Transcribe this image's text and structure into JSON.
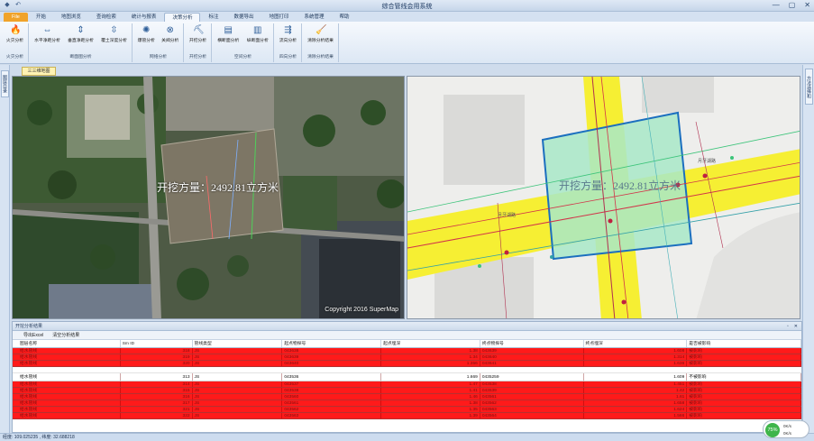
{
  "window": {
    "title": "综合管线会用系统",
    "controls": [
      "—",
      "▢",
      "✕"
    ]
  },
  "ribbon_tabs": [
    "File",
    "开始",
    "地图浏览",
    "查询检索",
    "统计与报表",
    "决策分析",
    "标注",
    "数据导出",
    "地图打印",
    "系统管理",
    "帮助"
  ],
  "ribbon": {
    "groups": [
      {
        "label": "火灾分析",
        "buttons": [
          {
            "label": "火灾分析",
            "icon": "fire-icon"
          }
        ]
      },
      {
        "label": "断面图分析",
        "buttons": [
          {
            "label": "水平净距分析",
            "icon": "horizontal-distance-icon"
          },
          {
            "label": "垂直净距分析",
            "icon": "vertical-distance-icon"
          },
          {
            "label": "覆土深度分析",
            "icon": "depth-icon"
          }
        ]
      },
      {
        "label": "网络分析",
        "buttons": [
          {
            "label": "爆管分析",
            "icon": "pipe-burst-icon"
          },
          {
            "label": "关阀分析",
            "icon": "valve-icon"
          }
        ]
      },
      {
        "label": "开挖分析",
        "buttons": [
          {
            "label": "开挖分析",
            "icon": "excavation-icon"
          }
        ]
      },
      {
        "label": "空间分析",
        "buttons": [
          {
            "label": "横断面分析",
            "icon": "cross-section-icon"
          },
          {
            "label": "纵断面分析",
            "icon": "profile-icon"
          }
        ]
      },
      {
        "label": "四向分析",
        "buttons": [
          {
            "label": "流向分析",
            "icon": "flow-icon"
          }
        ]
      },
      {
        "label": "清除分析结果",
        "buttons": [
          {
            "label": "清除分析结果",
            "icon": "broom-icon"
          }
        ]
      }
    ]
  },
  "left_dock": {
    "tab": "图层目录"
  },
  "right_dock": {
    "tab": "方法选择和"
  },
  "document_tab": "三三维地图",
  "map_left": {
    "overlay": "开挖方量：2492.81立方米",
    "copyright": "Copyright 2016 SuperMap"
  },
  "map_right": {
    "overlay": "开挖方量：2492.81立方米",
    "labels": [
      "月牙湖路",
      "月牙湖路"
    ]
  },
  "panel": {
    "title": "开挖分析结果",
    "tools": [
      "导出Excel",
      "清空分析结果"
    ],
    "columns": [
      "图层名称",
      "Sm ID",
      "管线类型",
      "起点物探号",
      "起点埋深",
      "终点物探号",
      "终点埋深",
      "是否被影响"
    ],
    "highlight_row": {
      "layer": "给水管线",
      "smid": "313",
      "type": "JS",
      "start_id": "043536",
      "start_depth": "1.669",
      "end_id": "0435259",
      "end_depth": "1.609",
      "affected": "不被影响"
    },
    "red_rows_top": [
      {
        "layer": "给水管线",
        "smid": "318",
        "type": "JS",
        "start_id": "043638",
        "start_depth": "1.38",
        "end_id": "043639",
        "end_depth": "1.608",
        "affected": "被影响"
      },
      {
        "layer": "给水管线",
        "smid": "319",
        "type": "JS",
        "start_id": "043639",
        "start_depth": "1.34",
        "end_id": "043640",
        "end_depth": "1.314",
        "affected": "被影响"
      },
      {
        "layer": "给水管线",
        "smid": "320",
        "type": "JS",
        "start_id": "043640",
        "start_depth": "1.356",
        "end_id": "043641",
        "end_depth": "1.636",
        "affected": "被影响"
      }
    ],
    "red_rows_bottom": [
      {
        "layer": "给水管线",
        "smid": "314",
        "type": "JS",
        "start_id": "043537",
        "start_depth": "1.47",
        "end_id": "043538",
        "end_depth": "1.451",
        "affected": "被影响"
      },
      {
        "layer": "给水管线",
        "smid": "315",
        "type": "JS",
        "start_id": "043538",
        "start_depth": "1.41",
        "end_id": "043539",
        "end_depth": "1.42",
        "affected": "被影响"
      },
      {
        "layer": "给水管线",
        "smid": "316",
        "type": "JS",
        "start_id": "043560",
        "start_depth": "1.46",
        "end_id": "043561",
        "end_depth": "1.61",
        "affected": "被影响"
      },
      {
        "layer": "给水管线",
        "smid": "317",
        "type": "JS",
        "start_id": "043561",
        "start_depth": "1.38",
        "end_id": "043562",
        "end_depth": "1.658",
        "affected": "被影响"
      },
      {
        "layer": "给水管线",
        "smid": "321",
        "type": "JS",
        "start_id": "043562",
        "start_depth": "1.35",
        "end_id": "043563",
        "end_depth": "1.624",
        "affected": "被影响"
      },
      {
        "layer": "给水管线",
        "smid": "322",
        "type": "JS",
        "start_id": "043563",
        "start_depth": "1.39",
        "end_id": "043564",
        "end_depth": "1.566",
        "affected": "被影响"
      }
    ]
  },
  "status": {
    "text": "经度: 109.025235 , 纬度: 32.688218"
  },
  "net": {
    "percent": "75%",
    "up": "0K/s",
    "down": "0K/s"
  },
  "colors": {
    "ribbon_bg": "#dce7f4",
    "file_tab": "#f0a32a",
    "row_red": "#ff1a1a",
    "road_yellow": "#f6ef33",
    "excavation_fill": "#a8e8c8",
    "excavation_border": "#1b6fbf"
  }
}
